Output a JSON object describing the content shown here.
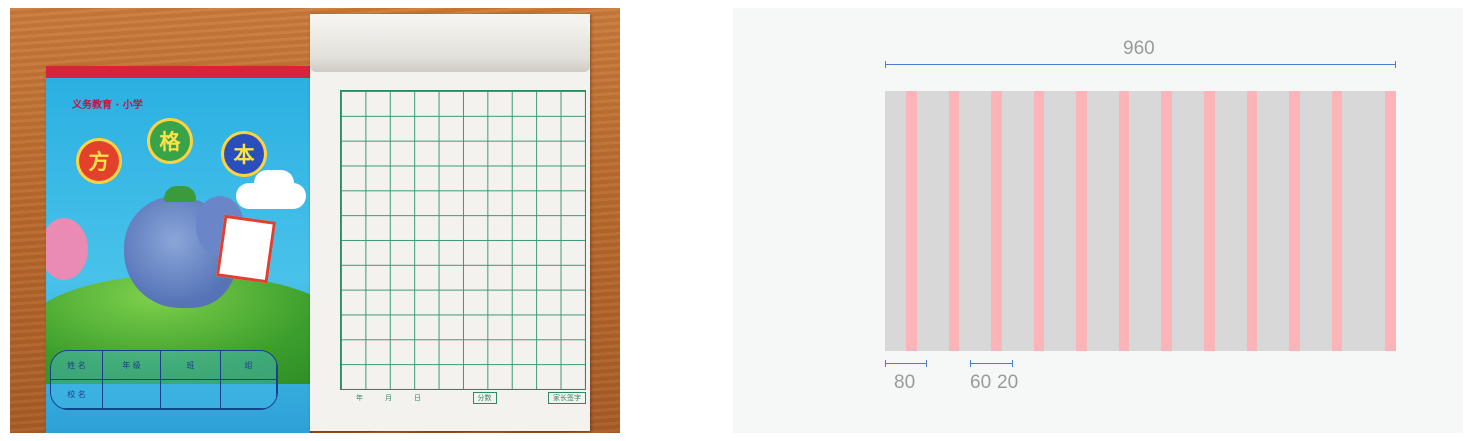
{
  "photo": {
    "notebook_series": "义务教育 · 小学",
    "notebook_title_chars": [
      "方",
      "格",
      "本"
    ],
    "name_table_cells": [
      "姓 名",
      "年 级",
      "班",
      "组",
      "校 名",
      "",
      "",
      ""
    ],
    "pad_footer": [
      "年",
      "月",
      "日",
      "分数",
      "家长签字"
    ]
  },
  "diagram": {
    "total_width_label": "960",
    "column_width_label": "80",
    "unit_width_label": "60",
    "gutter_width_label": "20",
    "column_count": 12,
    "column_color": "#d8d8d8",
    "gutter_color": "#fcb4b8",
    "dimension_line_color": "#4a7fd0"
  }
}
